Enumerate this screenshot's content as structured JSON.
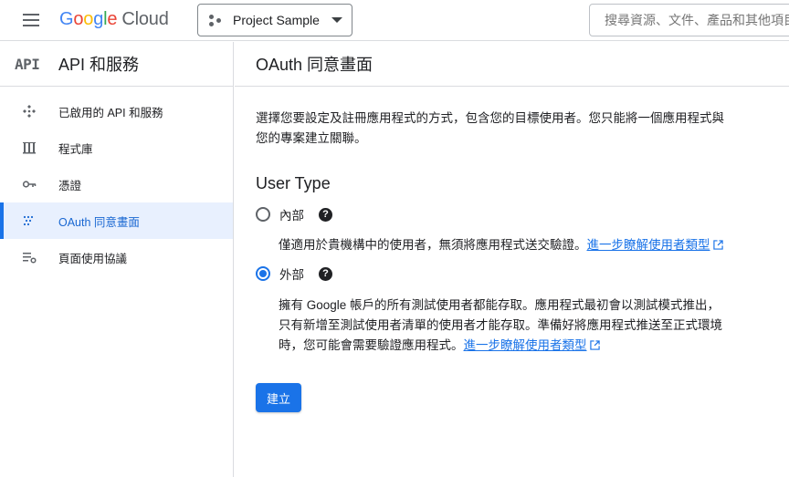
{
  "header": {
    "logo": {
      "letters": [
        "G",
        "o",
        "o",
        "g",
        "l",
        "e"
      ],
      "product": "Cloud"
    },
    "project_picker": {
      "label": "Project Sample"
    },
    "search": {
      "placeholder": "搜尋資源、文件、產品和其他項目"
    }
  },
  "sidebar": {
    "badge": "API",
    "title": "API 和服務",
    "items": [
      {
        "label": "已啟用的 API 和服務",
        "icon": "apis-icon",
        "active": false
      },
      {
        "label": "程式庫",
        "icon": "library-icon",
        "active": false
      },
      {
        "label": "憑證",
        "icon": "key-icon",
        "active": false
      },
      {
        "label": "OAuth 同意畫面",
        "icon": "oauth-consent-icon",
        "active": true
      },
      {
        "label": "頁面使用協議",
        "icon": "page-usage-icon",
        "active": false
      }
    ]
  },
  "main": {
    "title": "OAuth 同意畫面",
    "intro": "選擇您要設定及註冊應用程式的方式，包含您的目標使用者。您只能將一個應用程式與您的專案建立關聯。",
    "user_type_heading": "User Type",
    "options": [
      {
        "label": "內部",
        "checked": false,
        "description": "僅適用於貴機構中的使用者，無須將應用程式送交驗證。",
        "link": "進一步瞭解使用者類型"
      },
      {
        "label": "外部",
        "checked": true,
        "description": "擁有 Google 帳戶的所有測試使用者都能存取。應用程式最初會以測試模式推出，只有新增至測試使用者清單的使用者才能存取。準備好將應用程式推送至正式環境時，您可能會需要驗證應用程式。",
        "link": "進一步瞭解使用者類型"
      }
    ],
    "help_glyph": "?",
    "create_button": "建立"
  },
  "colors": {
    "accent": "#1a73e8",
    "active_bg": "#e8f0fe",
    "border": "#dadce0"
  }
}
